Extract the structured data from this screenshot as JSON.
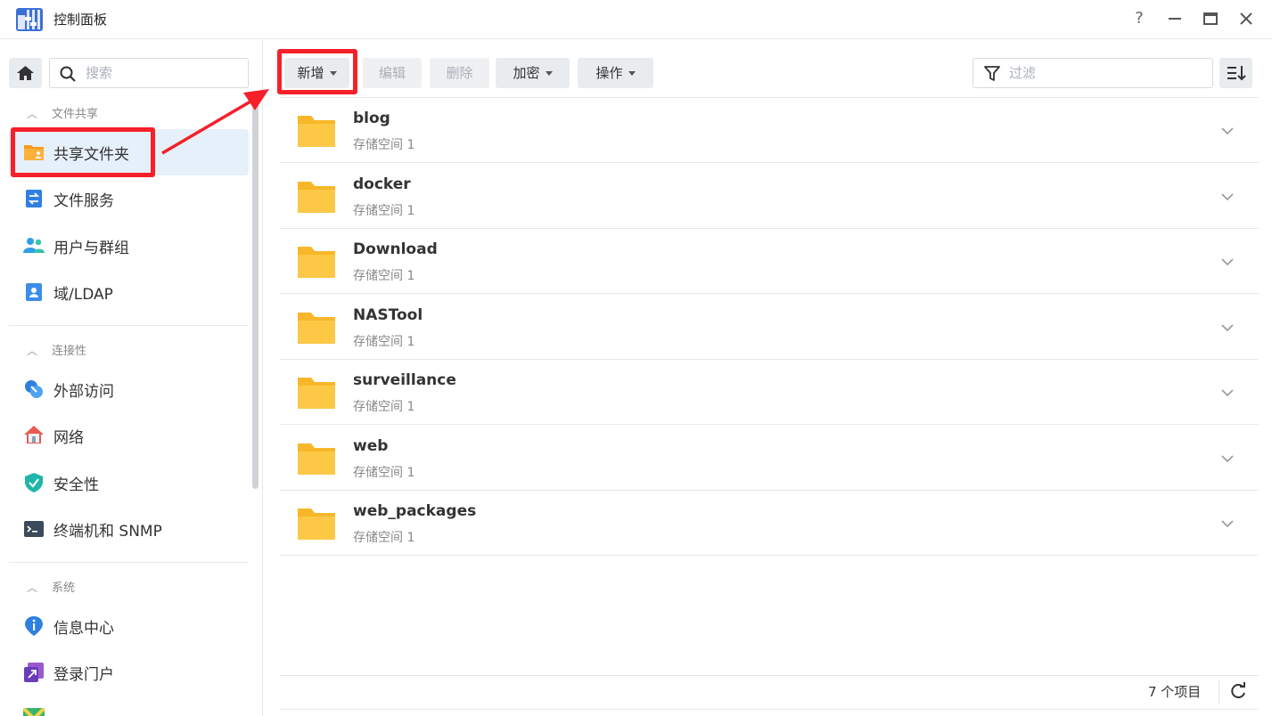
{
  "window": {
    "title": "控制面板",
    "controls": {
      "help": "?",
      "minimize": "—",
      "maximize": "▢",
      "close": "✕"
    }
  },
  "sidebar": {
    "search_placeholder": "搜索",
    "sections": [
      {
        "title": "文件共享",
        "items": [
          {
            "label": "共享文件夹",
            "icon": "shared-folder-icon",
            "active": true
          },
          {
            "label": "文件服务",
            "icon": "file-services-icon"
          },
          {
            "label": "用户与群组",
            "icon": "users-groups-icon"
          },
          {
            "label": "域/LDAP",
            "icon": "domain-ldap-icon"
          }
        ]
      },
      {
        "title": "连接性",
        "items": [
          {
            "label": "外部访问",
            "icon": "external-access-icon"
          },
          {
            "label": "网络",
            "icon": "network-icon"
          },
          {
            "label": "安全性",
            "icon": "security-shield-icon"
          },
          {
            "label": "终端机和 SNMP",
            "icon": "terminal-icon"
          }
        ]
      },
      {
        "title": "系统",
        "items": [
          {
            "label": "信息中心",
            "icon": "info-center-icon"
          },
          {
            "label": "登录门户",
            "icon": "login-portal-icon"
          }
        ]
      }
    ]
  },
  "toolbar": {
    "create": "新增",
    "edit": "编辑",
    "delete": "删除",
    "encrypt": "加密",
    "action": "操作",
    "filter_placeholder": "过滤"
  },
  "folders": [
    {
      "name": "blog",
      "volume": "存储空间 1"
    },
    {
      "name": "docker",
      "volume": "存储空间 1"
    },
    {
      "name": "Download",
      "volume": "存储空间 1"
    },
    {
      "name": "NASTool",
      "volume": "存储空间 1"
    },
    {
      "name": "surveillance",
      "volume": "存储空间 1"
    },
    {
      "name": "web",
      "volume": "存储空间 1"
    },
    {
      "name": "web_packages",
      "volume": "存储空间 1"
    }
  ],
  "status": {
    "item_count": "7 个项目"
  },
  "colors": {
    "accent": "#e6f0fb",
    "highlight": "#f5202a",
    "folder": "#fcc846"
  }
}
